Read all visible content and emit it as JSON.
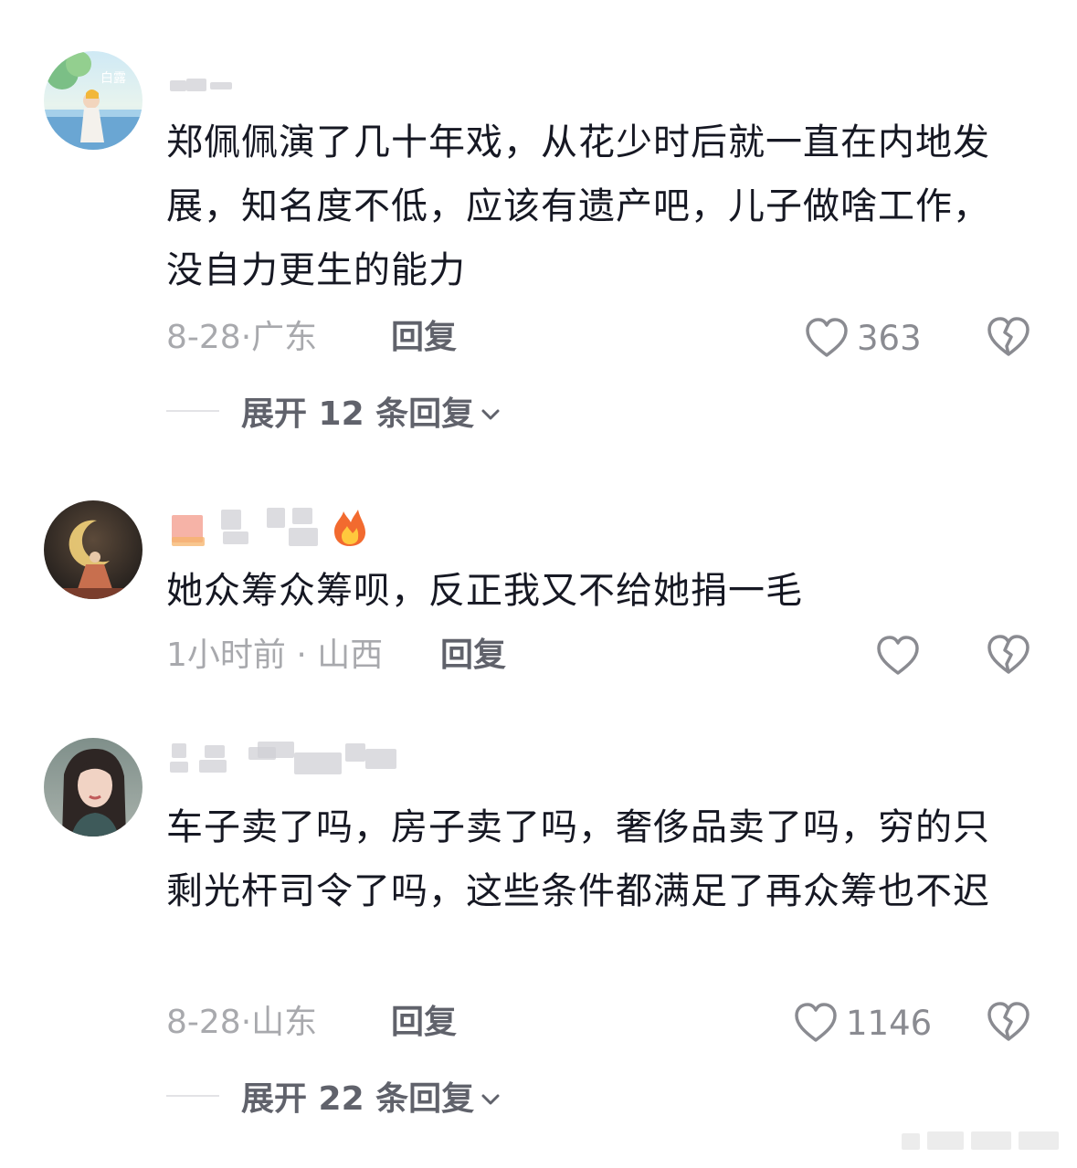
{
  "comments": [
    {
      "text": "郑佩佩演了几十年戏，从花少时后就一直在内地发展，知名度不低，应该有遗产吧，儿子做啥工作，没自力更生的能力",
      "date": "8-28",
      "separator": "·",
      "location": "广东",
      "reply_label": "回复",
      "likes": "363",
      "expand_text": "展开 12 条回复"
    },
    {
      "text": "她众筹众筹呗，反正我又不给她捐一毛",
      "date": "1小时前",
      "separator": " · ",
      "location": "山西",
      "reply_label": "回复",
      "likes": ""
    },
    {
      "text": "车子卖了吗，房子卖了吗，奢侈品卖了吗，穷的只剩光杆司令了吗，这些条件都满足了再众筹也不迟",
      "date": "8-28",
      "separator": "·",
      "location": "山东",
      "reply_label": "回复",
      "likes": "1146",
      "expand_text": "展开 22 条回复"
    }
  ],
  "icons": {
    "like": "heart-outline-icon",
    "dislike": "broken-heart-icon",
    "expand": "chevron-down-icon",
    "badge": "fire-icon"
  },
  "colors": {
    "text": "#161823",
    "meta": "#a8a9ad",
    "reply": "#60626b",
    "icon": "#8a8b91"
  }
}
